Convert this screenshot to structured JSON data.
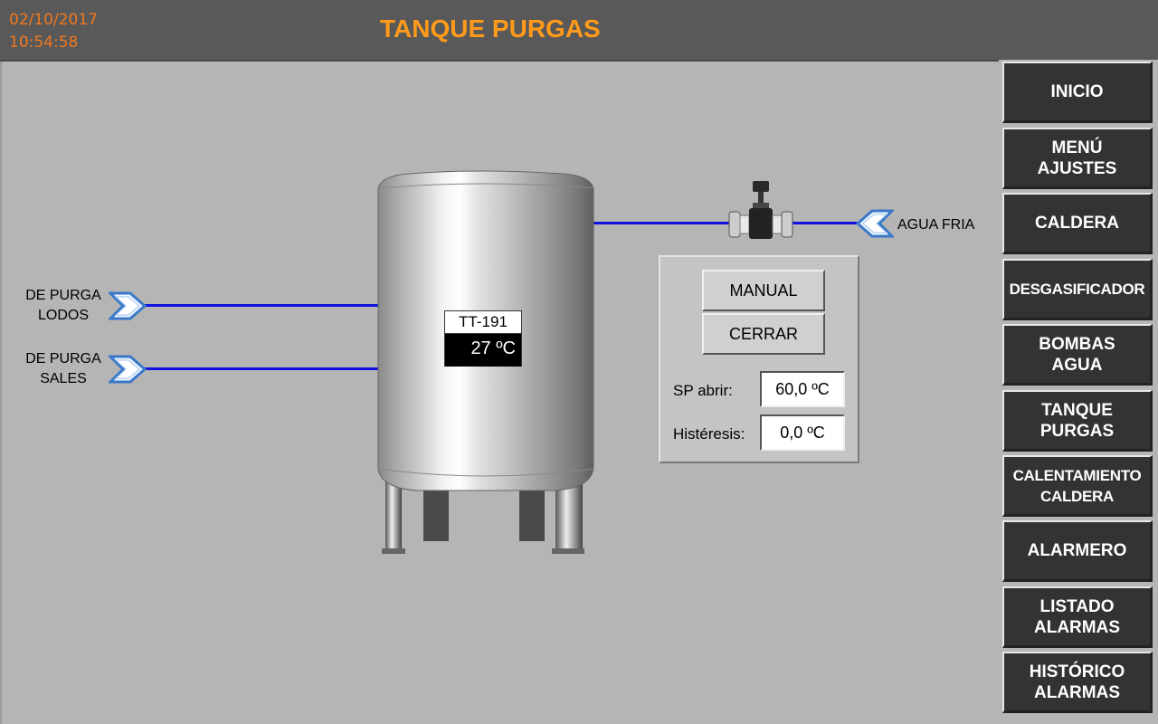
{
  "header": {
    "date": "02/10/2017",
    "time": "10:54:58",
    "title": "TANQUE PURGAS"
  },
  "nav": [
    {
      "label": "INICIO"
    },
    {
      "label": "MENÚ\nAJUSTES"
    },
    {
      "label": "CALDERA"
    },
    {
      "label": "DESGASIFICADOR"
    },
    {
      "label": "BOMBAS\nAGUA"
    },
    {
      "label": "TANQUE\nPURGAS"
    },
    {
      "label": "CALENTAMIENTO\nCALDERA"
    },
    {
      "label": "ALARMERO"
    },
    {
      "label": "LISTADO\nALARMAS"
    },
    {
      "label": "HISTÓRICO\nALARMAS"
    }
  ],
  "inlets": {
    "lodos": "DE PURGA\nLODOS",
    "sales": "DE PURGA\nSALES",
    "agua_fria": "AGUA FRIA"
  },
  "sensor": {
    "name": "TT-191",
    "value": "27 ºC"
  },
  "control_panel": {
    "manual_label": "MANUAL",
    "cerrar_label": "CERRAR",
    "sp_label": "SP abrir:",
    "sp_value": "60,0 ºC",
    "hist_label": "Histéresis:",
    "hist_value": "0,0 ºC"
  },
  "colors": {
    "pipe": "#1010e0",
    "header_text": "#ff9a1a",
    "nav_bg": "#333333"
  }
}
